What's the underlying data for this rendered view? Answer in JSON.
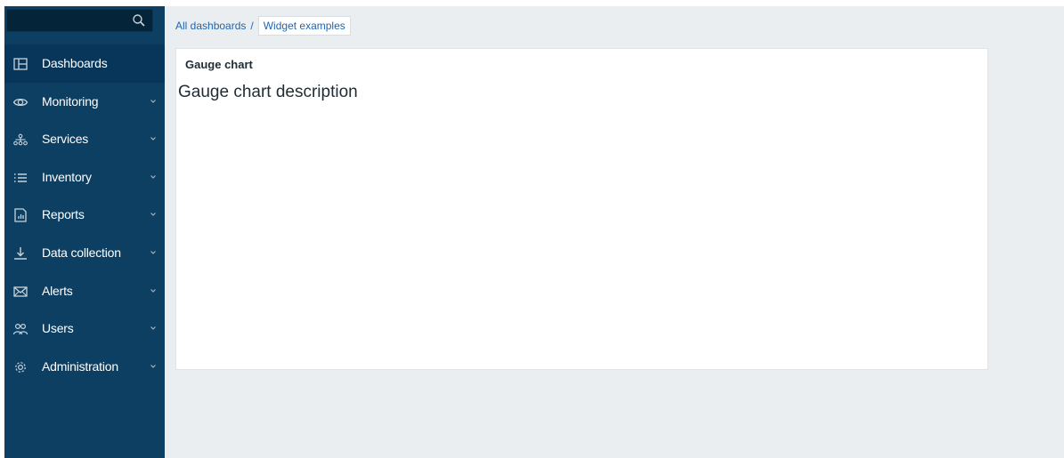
{
  "sidebar": {
    "search": {
      "value": "",
      "placeholder": ""
    },
    "items": [
      {
        "label": "Dashboards",
        "icon": "dashboards-icon",
        "has_chevron": false,
        "active": true
      },
      {
        "label": "Monitoring",
        "icon": "eye-icon",
        "has_chevron": true,
        "active": false
      },
      {
        "label": "Services",
        "icon": "services-icon",
        "has_chevron": true,
        "active": false
      },
      {
        "label": "Inventory",
        "icon": "list-icon",
        "has_chevron": true,
        "active": false
      },
      {
        "label": "Reports",
        "icon": "report-icon",
        "has_chevron": true,
        "active": false
      },
      {
        "label": "Data collection",
        "icon": "download-icon",
        "has_chevron": true,
        "active": false
      },
      {
        "label": "Alerts",
        "icon": "envelope-icon",
        "has_chevron": true,
        "active": false
      },
      {
        "label": "Users",
        "icon": "users-icon",
        "has_chevron": true,
        "active": false
      },
      {
        "label": "Administration",
        "icon": "gear-icon",
        "has_chevron": true,
        "active": false
      }
    ]
  },
  "breadcrumb": {
    "root": "All dashboards",
    "separator": "/",
    "current": "Widget examples"
  },
  "widget": {
    "title": "Gauge chart",
    "description": "Gauge chart description"
  },
  "colors": {
    "sidebar_bg": "#0c3f62",
    "sidebar_active": "#08365a",
    "link": "#1f65b0",
    "page_bg": "#ebeef0"
  }
}
